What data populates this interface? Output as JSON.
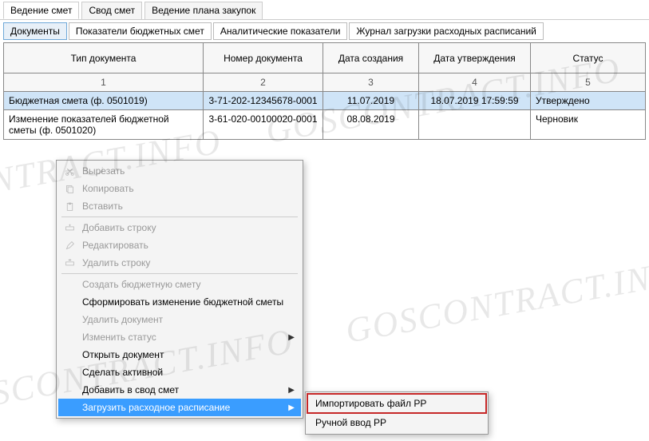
{
  "topTabs": {
    "t0": "Ведение смет",
    "t1": "Свод смет",
    "t2": "Ведение плана закупок"
  },
  "subTabs": {
    "s0": "Документы",
    "s1": "Показатели бюджетных смет",
    "s2": "Аналитические показатели",
    "s3": "Журнал загрузки расходных расписаний"
  },
  "columns": {
    "c1": "Тип документа",
    "c2": "Номер документа",
    "c3": "Дата создания",
    "c4": "Дата утверждения",
    "c5": "Статус"
  },
  "colnums": {
    "n1": "1",
    "n2": "2",
    "n3": "3",
    "n4": "4",
    "n5": "5"
  },
  "rows": [
    {
      "type": "Бюджетная смета (ф. 0501019)",
      "num": "3-71-202-12345678-0001",
      "created": "11.07.2019",
      "approved": "18.07.2019 17:59:59",
      "status": "Утверждено"
    },
    {
      "type": "Изменение показателей бюджетной сметы (ф. 0501020)",
      "num": "3-61-020-00100020-0001",
      "created": "08.08.2019",
      "approved": "",
      "status": "Черновик"
    }
  ],
  "cmenu": {
    "cut": "Вырезать",
    "copy": "Копировать",
    "paste": "Вставить",
    "addRow": "Добавить строку",
    "edit": "Редактировать",
    "delRow": "Удалить строку",
    "createBudget": "Создать бюджетную смету",
    "formChange": "Сформировать изменение бюджетной сметы",
    "delDoc": "Удалить документ",
    "changeStatus": "Изменить статус",
    "openDoc": "Открыть документ",
    "makeActive": "Сделать активной",
    "addToSvod": "Добавить в свод смет",
    "loadRR": "Загрузить расходное расписание"
  },
  "submenu": {
    "importRR": "Импортировать файл РР",
    "manualRR": "Ручной ввод РР"
  },
  "watermark": "GOSCONTRACT.INFO"
}
